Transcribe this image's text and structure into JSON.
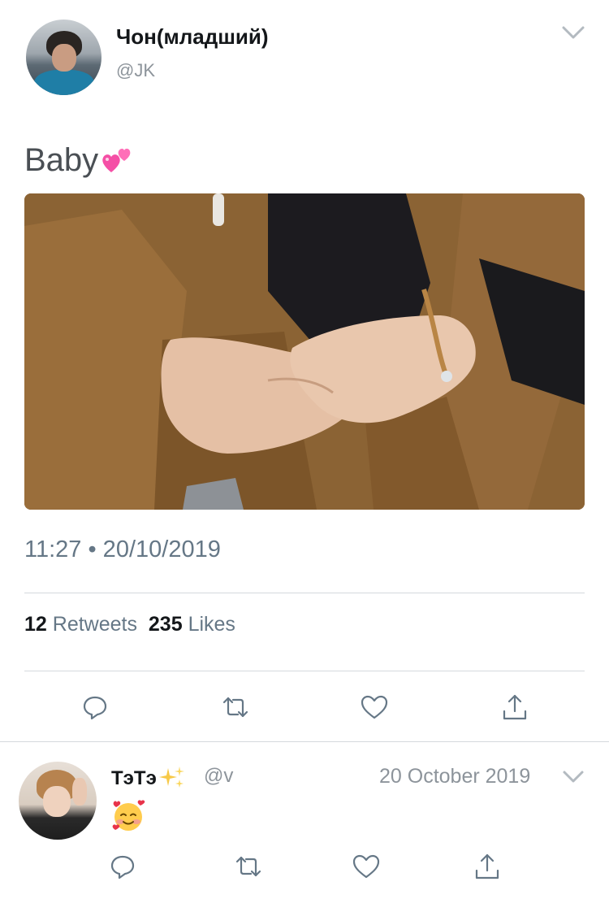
{
  "tweet": {
    "display_name": "Чон(младший)",
    "handle": "@JK",
    "text": "Baby",
    "emoji": "two-hearts",
    "timestamp": "11:27 • 20/10/2019",
    "stats": {
      "retweets_count": "12",
      "retweets_label": "Retweets",
      "likes_count": "235",
      "likes_label": "Likes"
    },
    "actions": [
      "reply-icon",
      "retweet-icon",
      "like-icon",
      "share-icon"
    ]
  },
  "reply": {
    "display_name": "ТэТэ",
    "name_emoji": "sparkles",
    "handle": "@v",
    "date": "20 October 2019",
    "content_emoji": "smiling-face-with-hearts",
    "actions": [
      "reply-icon",
      "retweet-icon",
      "like-icon",
      "share-icon"
    ]
  },
  "colors": {
    "text_primary": "#14171a",
    "text_secondary": "#657786",
    "icon": "#657786",
    "divider": "#d5d9dd"
  }
}
